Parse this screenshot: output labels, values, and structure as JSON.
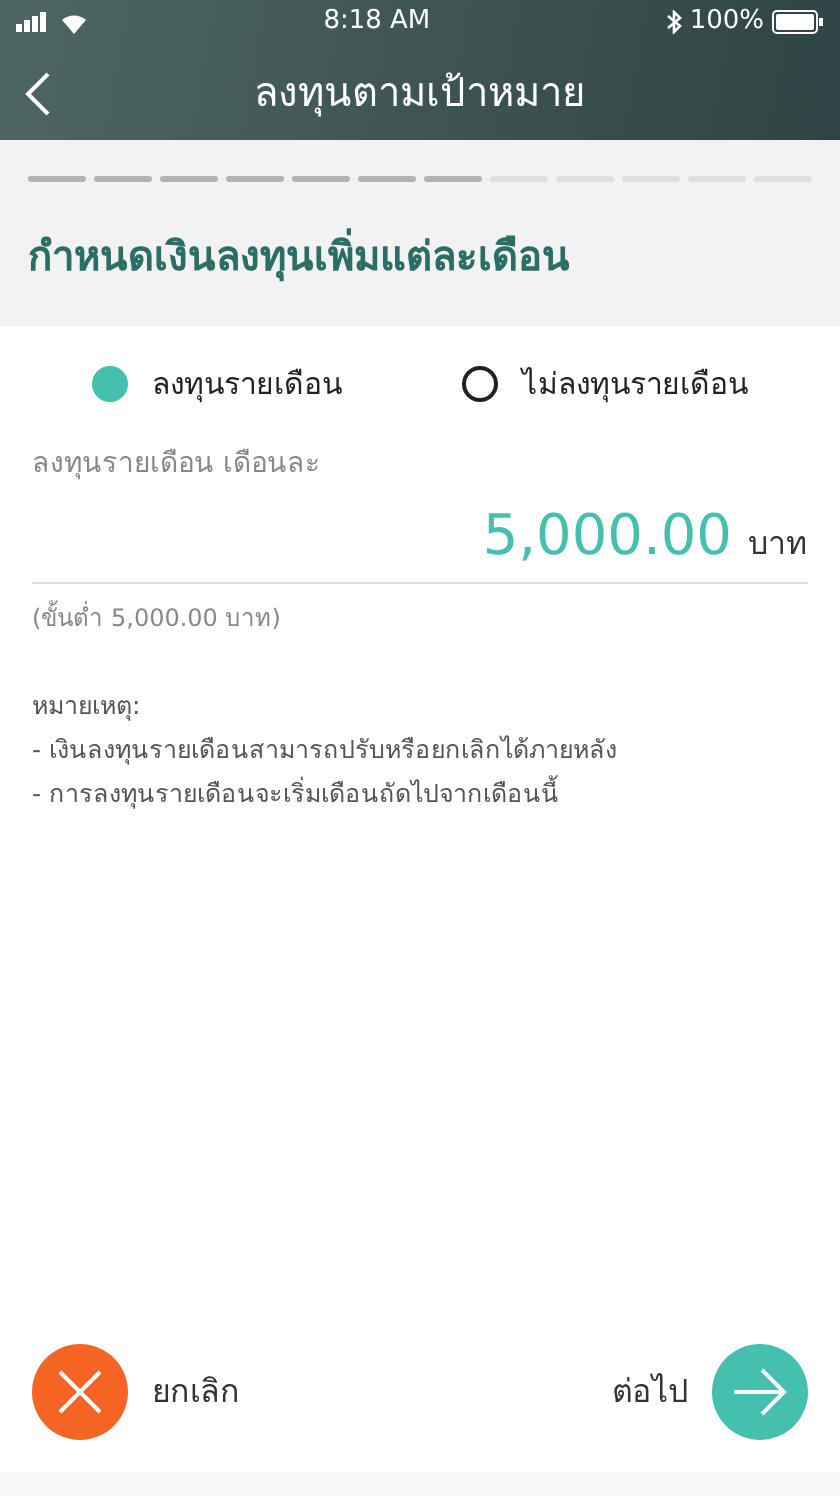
{
  "status_bar": {
    "time": "8:18 AM",
    "battery": "100%"
  },
  "header": {
    "title": "ลงทุนตามเป้าหมาย"
  },
  "progress_steps": [
    {
      "done": true
    },
    {
      "done": true
    },
    {
      "done": true
    },
    {
      "done": true
    },
    {
      "done": true
    },
    {
      "done": true
    },
    {
      "done": true
    },
    {
      "done": false
    },
    {
      "done": false
    },
    {
      "done": false
    },
    {
      "done": false
    },
    {
      "done": false
    }
  ],
  "section_title": "กำหนดเงินลงทุนเพิ่มแต่ละเดือน",
  "options": [
    {
      "label": "ลงทุนรายเดือน",
      "selected": true
    },
    {
      "label": "ไม่ลงทุนรายเดือน",
      "selected": false
    }
  ],
  "amount": {
    "label": "ลงทุนรายเดือน เดือนละ",
    "value": "5,000.00",
    "unit": "บาท",
    "hint": "(ขั้นต่ำ 5,000.00 บาท)"
  },
  "notes": [
    "หมายเหตุ:",
    "- เงินลงทุนรายเดือนสามารถปรับหรือยกเลิกได้ภายหลัง",
    "- การลงทุนรายเดือนจะเริ่มเดือนถัดไปจากเดือนนี้"
  ],
  "footer": {
    "cancel": "ยกเลิก",
    "next": "ต่อไป"
  }
}
